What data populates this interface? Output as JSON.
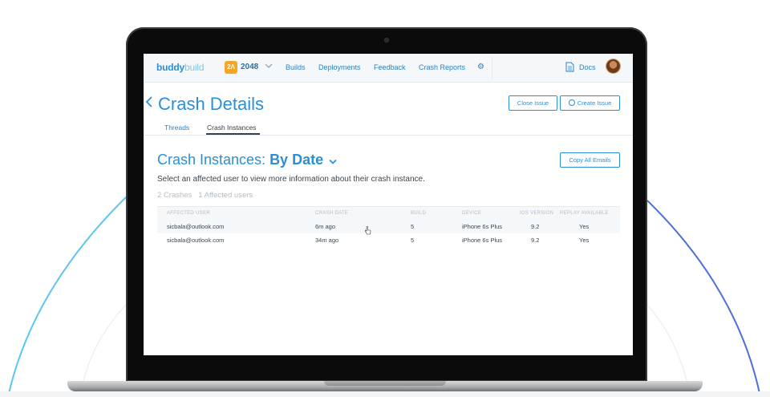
{
  "app": {
    "logo_bold": "buddy",
    "logo_light": "build",
    "badge": "2Λ",
    "name": "2048"
  },
  "nav": {
    "items": [
      "Builds",
      "Deployments",
      "Feedback",
      "Crash Reports"
    ],
    "docs_label": "Docs"
  },
  "page": {
    "title": "Crash Details",
    "close_issue_label": "Close Issue",
    "create_issue_label": "Create Issue",
    "tabs": [
      "Threads",
      "Crash Instances"
    ],
    "active_tab": "Crash Instances"
  },
  "crash_instances": {
    "heading_prefix": "Crash Instances: ",
    "sort_label": "By Date",
    "copy_emails_label": "Copy All Emails",
    "help_text": "Select an affected user to view more information about their crash instance.",
    "counts": "2 Crashes   1 Affected users",
    "columns": [
      "Affected User",
      "Crash Date",
      "Build",
      "Device",
      "iOS Version",
      "Replay Available"
    ],
    "rows": [
      {
        "user": "sicbala@outlook.com",
        "date": "6m ago",
        "build": "5",
        "device": "iPhone 6s Plus",
        "ios": "9.2",
        "replay": "Yes"
      },
      {
        "user": "sicbala@outlook.com",
        "date": "34m ago",
        "build": "5",
        "device": "iPhone 6s Plus",
        "ios": "9.2",
        "replay": "Yes"
      }
    ]
  },
  "colors": {
    "accent": "#2b8fd6",
    "arc_left": "#5bc6ee",
    "arc_right": "#4f6fd8",
    "badge": "#f5a623"
  },
  "icons": {
    "app_chevron": "chevron-down-icon",
    "settings": "gear-icon",
    "docs": "document-icon",
    "back": "chevron-left-icon",
    "create_issue": "github-icon",
    "sort": "chevron-down-icon",
    "cursor": "hand-pointer-icon"
  }
}
